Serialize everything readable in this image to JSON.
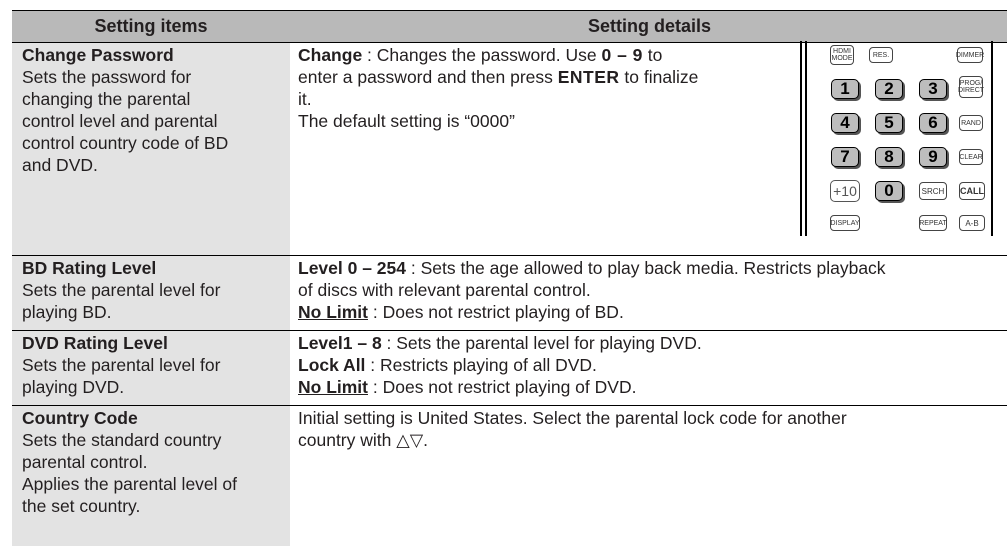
{
  "header": {
    "col1": "Setting items",
    "col2": "Setting details"
  },
  "rows": [
    {
      "title": "Change Password",
      "desc_lines": [
        "Sets the password for",
        "changing the parental",
        "control level and parental",
        "control country code of BD",
        "and DVD."
      ],
      "details": {
        "term": "Change",
        "l1_pre": " : Changes the password. Use ",
        "l1_keys": "0 – 9",
        "l1_post": " to",
        "l2_pre": "enter a password and then press ",
        "l2_key": "ENTER",
        "l2_post": " to finalize",
        "l3": "it.",
        "l4": "The default setting is “0000”"
      }
    },
    {
      "title": "BD Rating Level",
      "desc_lines": [
        "Sets the parental level for",
        "playing BD."
      ],
      "details": {
        "term1": "Level 0 – 254",
        "text1a": " : Sets the age allowed to play back media. Restricts playback",
        "text1b": "of discs with relevant parental control.",
        "term2": "No Limit",
        "text2": " : Does not restrict playing of BD."
      }
    },
    {
      "title": "DVD Rating Level",
      "desc_lines": [
        "Sets the parental level for",
        "playing DVD."
      ],
      "details": {
        "term1": "Level1 – 8",
        "text1": " : Sets the parental level for playing DVD.",
        "term2": "Lock All",
        "text2": " : Restricts playing of all DVD.",
        "term3": "No Limit",
        "text3": " : Does not restrict playing of DVD."
      }
    },
    {
      "title": "Country Code",
      "desc_lines": [
        "Sets the standard country",
        "parental control.",
        "Applies the parental level of",
        "the set country."
      ],
      "details": {
        "l1": "Initial setting is United States. Select the parental lock code for another",
        "l2": "country with △▽."
      }
    }
  ],
  "remote": {
    "hdmi_mode": "HDMI MODE",
    "res": "RES.",
    "dimmer": "DIMMER",
    "prog_direct": "PROG/ DIRECT",
    "rand": "RAND",
    "clear": "CLEAR",
    "plus10": "+10",
    "srch": "SRCH",
    "call": "CALL",
    "display": "DISPLAY",
    "repeat": "REPEAT",
    "ab": "A-B",
    "digits": [
      "1",
      "2",
      "3",
      "4",
      "5",
      "6",
      "7",
      "8",
      "9",
      "0"
    ]
  }
}
